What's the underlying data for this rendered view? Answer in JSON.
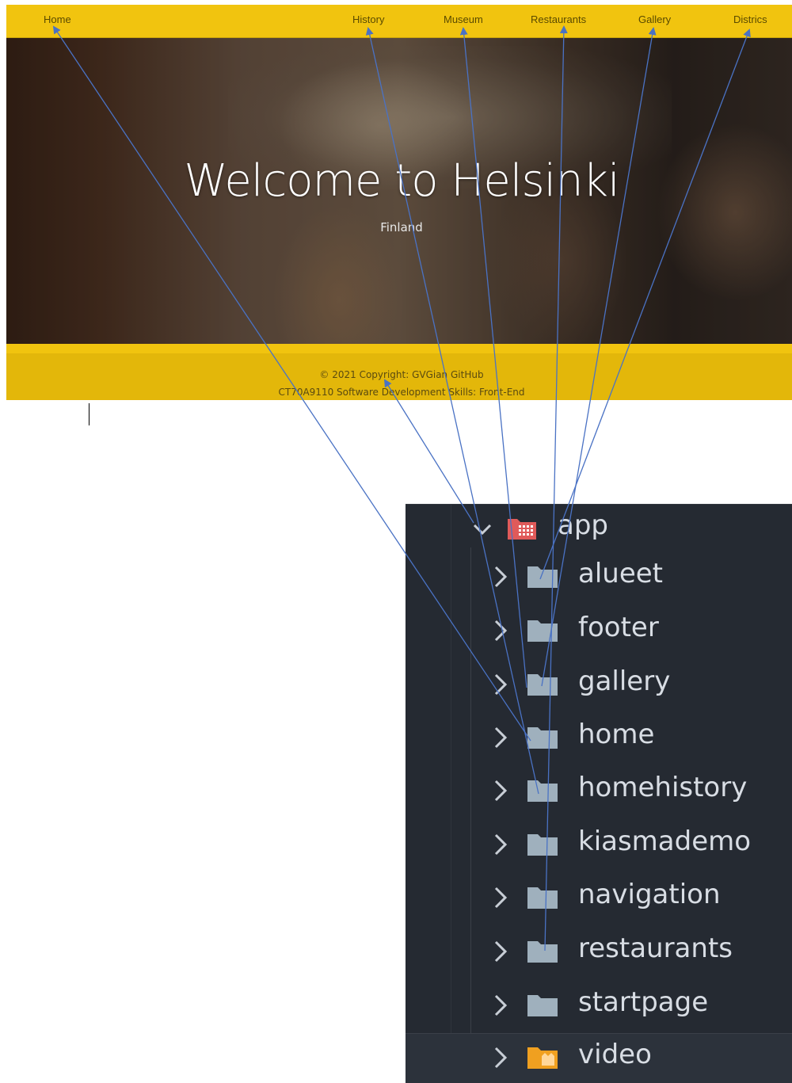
{
  "site": {
    "nav": {
      "home": "Home",
      "history": "History",
      "museum": "Museum",
      "restaurants": "Restaurants",
      "gallery": "Gallery",
      "districs": "Districs"
    },
    "hero": {
      "title": "Welcome to Helsinki",
      "subtitle": "Finland"
    },
    "footer": {
      "copyright": "© 2021 Copyright: GVGian GitHub",
      "course": "CT70A9110 Software Development Skills: Front-End"
    }
  },
  "explorer": {
    "root": "app",
    "folders": [
      "alueet",
      "footer",
      "gallery",
      "home",
      "homehistory",
      "kiasmademo",
      "navigation",
      "restaurants",
      "startpage",
      "video"
    ]
  },
  "colors": {
    "nav_yellow": "#f1c40f",
    "arrow_blue": "#4a72c4",
    "explorer_bg": "#252a32",
    "folder_grey": "#9fb0bd",
    "root_folder_red": "#e05a5a",
    "video_folder_orange": "#f0a020"
  },
  "icons": {
    "root": "app-folder-open-icon",
    "folder": "folder-icon",
    "video": "video-folder-icon",
    "collapse": "chevron-down-icon",
    "expand": "chevron-right-icon"
  }
}
